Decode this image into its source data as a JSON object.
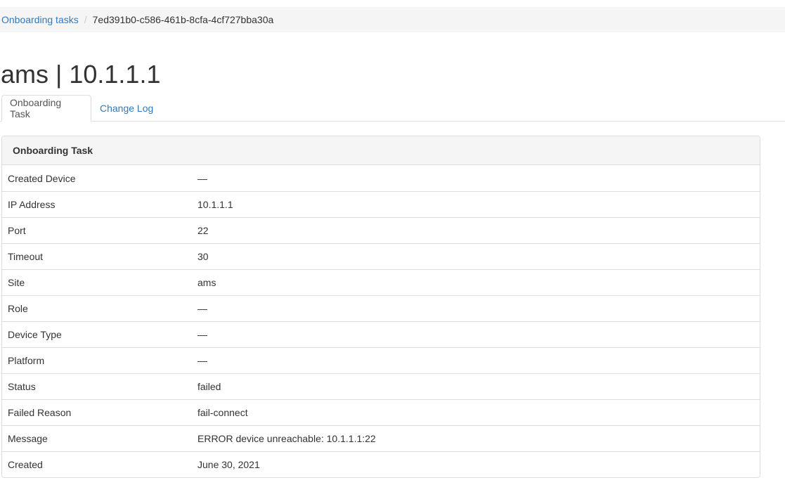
{
  "breadcrumb": {
    "parent_label": "Onboarding tasks",
    "separator": "/",
    "current": "7ed391b0-c586-461b-8cfa-4cf727bba30a"
  },
  "page": {
    "title": "ams | 10.1.1.1"
  },
  "tabs": [
    {
      "label": "Onboarding Task",
      "active": true
    },
    {
      "label": "Change Log",
      "active": false
    }
  ],
  "panel": {
    "heading": "Onboarding Task",
    "rows": [
      {
        "label": "Created Device",
        "value": "—"
      },
      {
        "label": "IP Address",
        "value": "10.1.1.1"
      },
      {
        "label": "Port",
        "value": "22"
      },
      {
        "label": "Timeout",
        "value": "30"
      },
      {
        "label": "Site",
        "value": "ams"
      },
      {
        "label": "Role",
        "value": "—"
      },
      {
        "label": "Device Type",
        "value": "—"
      },
      {
        "label": "Platform",
        "value": "—"
      },
      {
        "label": "Status",
        "value": "failed"
      },
      {
        "label": "Failed Reason",
        "value": "fail-connect"
      },
      {
        "label": "Message",
        "value": "ERROR device unreachable: 10.1.1.1:22"
      },
      {
        "label": "Created",
        "value": "June 30, 2021"
      }
    ]
  },
  "colors": {
    "link": "#337ab7",
    "text": "#333333",
    "border": "#dddddd",
    "muted_bg": "#f5f5f5"
  }
}
